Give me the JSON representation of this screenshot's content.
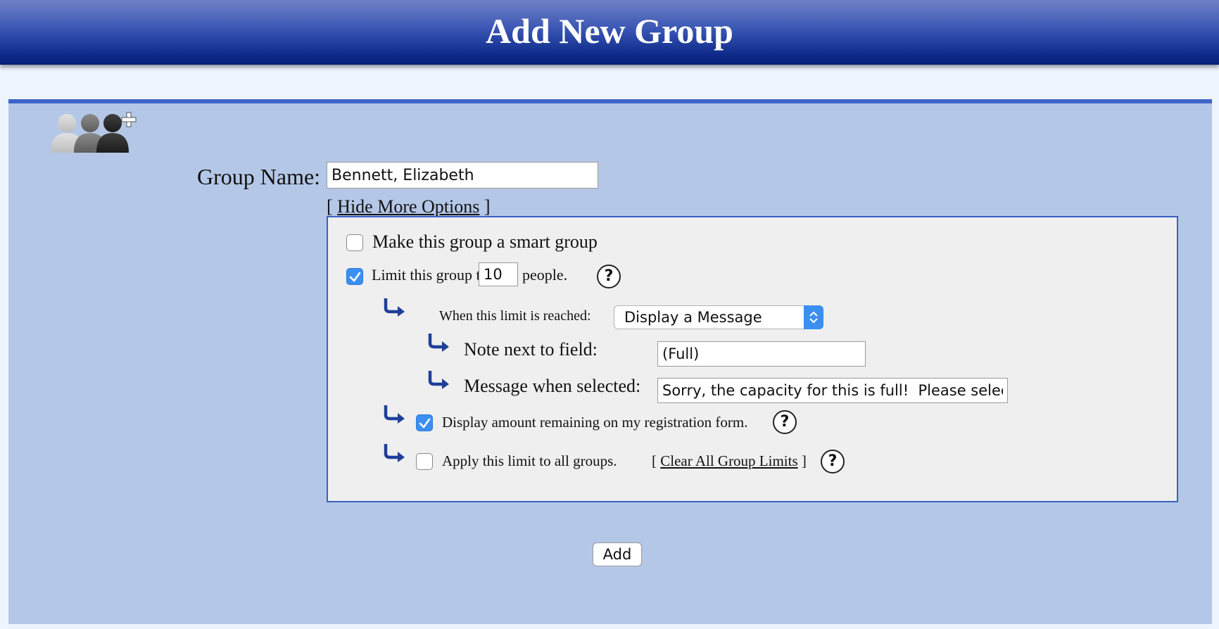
{
  "header": {
    "title": "Add New Group"
  },
  "form": {
    "group_name_label": "Group Name:",
    "group_name_value": "Bennett, Elizabeth",
    "toggle_prefix": "[",
    "toggle_link": "Hide More Options",
    "toggle_suffix": "]"
  },
  "options": {
    "smart_group": {
      "label": "Make this group a smart group",
      "checked": false
    },
    "limit": {
      "label_before": "Limit this group to",
      "value": "10",
      "label_after": "people.",
      "checked": true
    },
    "limit_action": {
      "label": "When this limit is reached:",
      "selected": "Display a Message"
    },
    "note": {
      "label": "Note next to field:",
      "value": "(Full)"
    },
    "message": {
      "label": "Message when selected:",
      "value": "Sorry, the capacity for this is full!  Please select"
    },
    "display_remaining": {
      "label": "Display amount remaining on my registration form.",
      "checked": true
    },
    "apply_all": {
      "label": "Apply this limit to all groups.",
      "checked": false
    },
    "clear_prefix": "[",
    "clear_link": "Clear All Group Limits",
    "clear_suffix": "]",
    "help_glyph": "?"
  },
  "actions": {
    "add_label": "Add"
  },
  "colors": {
    "header_top": "#6f81c4",
    "header_bottom": "#06207a",
    "panel_bg": "#b4c7e7",
    "panel_border": "#3e63c9",
    "options_bg": "#efefef",
    "checkbox_checked": "#3b8ff0",
    "arrow_color": "#1f3f9a"
  },
  "icons": {
    "group": "add-group-icon",
    "arrow": "curved-arrow-icon",
    "help": "help-icon",
    "select": "chevron-updown-icon",
    "check": "checkmark-icon"
  }
}
